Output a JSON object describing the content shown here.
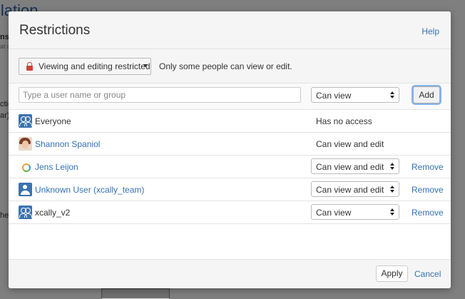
{
  "background": {
    "title_fragment": "llation",
    "fragments": [
      "ns",
      "at n",
      "ctio",
      "ar)",
      "he"
    ]
  },
  "dialog": {
    "title": "Restrictions",
    "help_label": "Help",
    "mode": {
      "selected_label": "Viewing and editing restricted",
      "description": "Only some people can view or edit."
    },
    "add": {
      "input_placeholder": "Type a user name or group",
      "input_value": "",
      "permission_value": "Can view",
      "add_label": "Add"
    },
    "entries": [
      {
        "icon": "group-icon",
        "name": "Everyone",
        "is_link": false,
        "permission": "Has no access",
        "editable": false
      },
      {
        "icon": "user-photo-icon",
        "name": "Shannon Spaniol",
        "is_link": true,
        "permission": "Can view and edit",
        "editable": false
      },
      {
        "icon": "logo-icon",
        "name": "Jens Leijon",
        "is_link": true,
        "permission": "Can view and edit",
        "editable": true,
        "remove_label": "Remove"
      },
      {
        "icon": "user-icon",
        "name": "Unknown User (xcally_team)",
        "is_link": true,
        "permission": "Can view and edit",
        "editable": true,
        "remove_label": "Remove"
      },
      {
        "icon": "group-icon",
        "name": "xcally_v2",
        "is_link": false,
        "permission": "Can view",
        "editable": true,
        "remove_label": "Remove"
      }
    ],
    "footer": {
      "apply_label": "Apply",
      "cancel_label": "Cancel"
    }
  },
  "colors": {
    "link": "#3572b0",
    "lock": "#d04437",
    "icon_blue": "#3b73af",
    "focus_ring": "#84b5ee"
  }
}
